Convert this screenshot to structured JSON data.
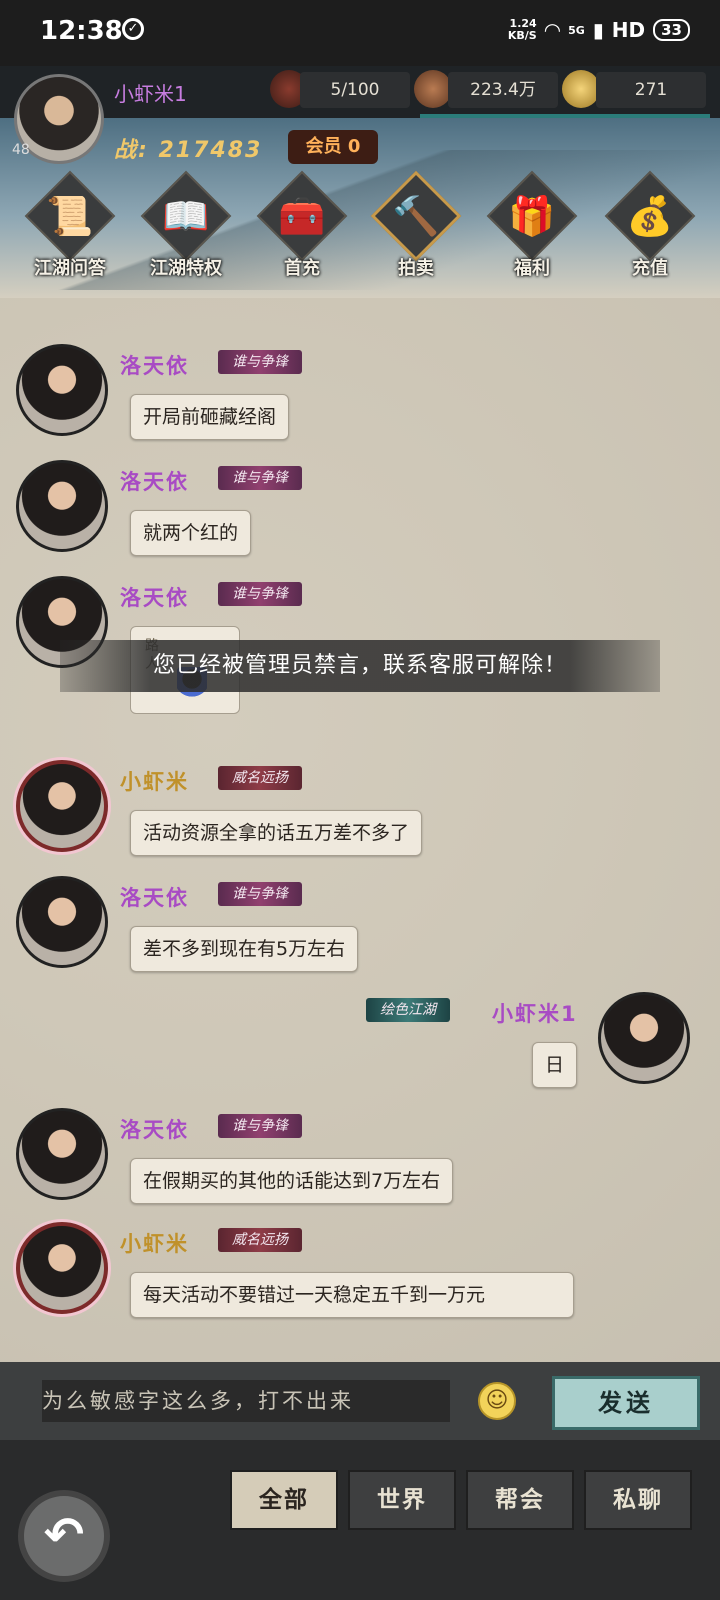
{
  "status_bar": {
    "time": "12:38",
    "speed_top": "1.24",
    "speed_bottom": "KB/S",
    "network": "5G",
    "hd": "HD",
    "battery": "33"
  },
  "player": {
    "name": "小虾米1",
    "level": "48",
    "power": "战: 217483",
    "vip": "会员 0"
  },
  "resources": [
    {
      "icon": "stamina-bottle-icon",
      "value": "5/100"
    },
    {
      "icon": "copper-coin-icon",
      "value": "223.4万"
    },
    {
      "icon": "gold-ingot-icon",
      "value": "271"
    }
  ],
  "menu": [
    {
      "label": "江湖问答",
      "icon": "scroll-icon"
    },
    {
      "label": "江湖特权",
      "icon": "book-icon"
    },
    {
      "label": "首充",
      "icon": "treasure-chest-icon"
    },
    {
      "label": "拍卖",
      "icon": "auction-hammer-icon"
    },
    {
      "label": "福利",
      "icon": "gift-basket-icon"
    },
    {
      "label": "充值",
      "icon": "gold-ingot-icon"
    }
  ],
  "messages": [
    {
      "name": "洛天依",
      "tag": "谁与争锋",
      "text": "开局前砸藏经阁"
    },
    {
      "name": "洛天依",
      "tag": "谁与争锋",
      "text": "就两个红的"
    },
    {
      "name": "洛天依",
      "tag": "谁与争锋",
      "sticker_text": "路人",
      "text": ""
    },
    {
      "name": "小虾米",
      "tag": "威名远扬",
      "text": "活动资源全拿的话五万差不多了"
    },
    {
      "name": "洛天依",
      "tag": "谁与争锋",
      "text": "差不多到现在有5万左右"
    },
    {
      "name": "小虾米1",
      "tag": "绘色江湖",
      "text": "日"
    },
    {
      "name": "洛天依",
      "tag": "谁与争锋",
      "text": "在假期买的其他的话能达到7万左右"
    },
    {
      "name": "小虾米",
      "tag": "威名远扬",
      "text": "每天活动不要错过一天稳定五千到一万元"
    }
  ],
  "toast": "您已经被管理员禁言，联系客服可解除！",
  "input": {
    "value": "为么敏感字这么多，打不出来"
  },
  "send_label": "发送",
  "tabs": [
    "全部",
    "世界",
    "帮会",
    "私聊"
  ]
}
